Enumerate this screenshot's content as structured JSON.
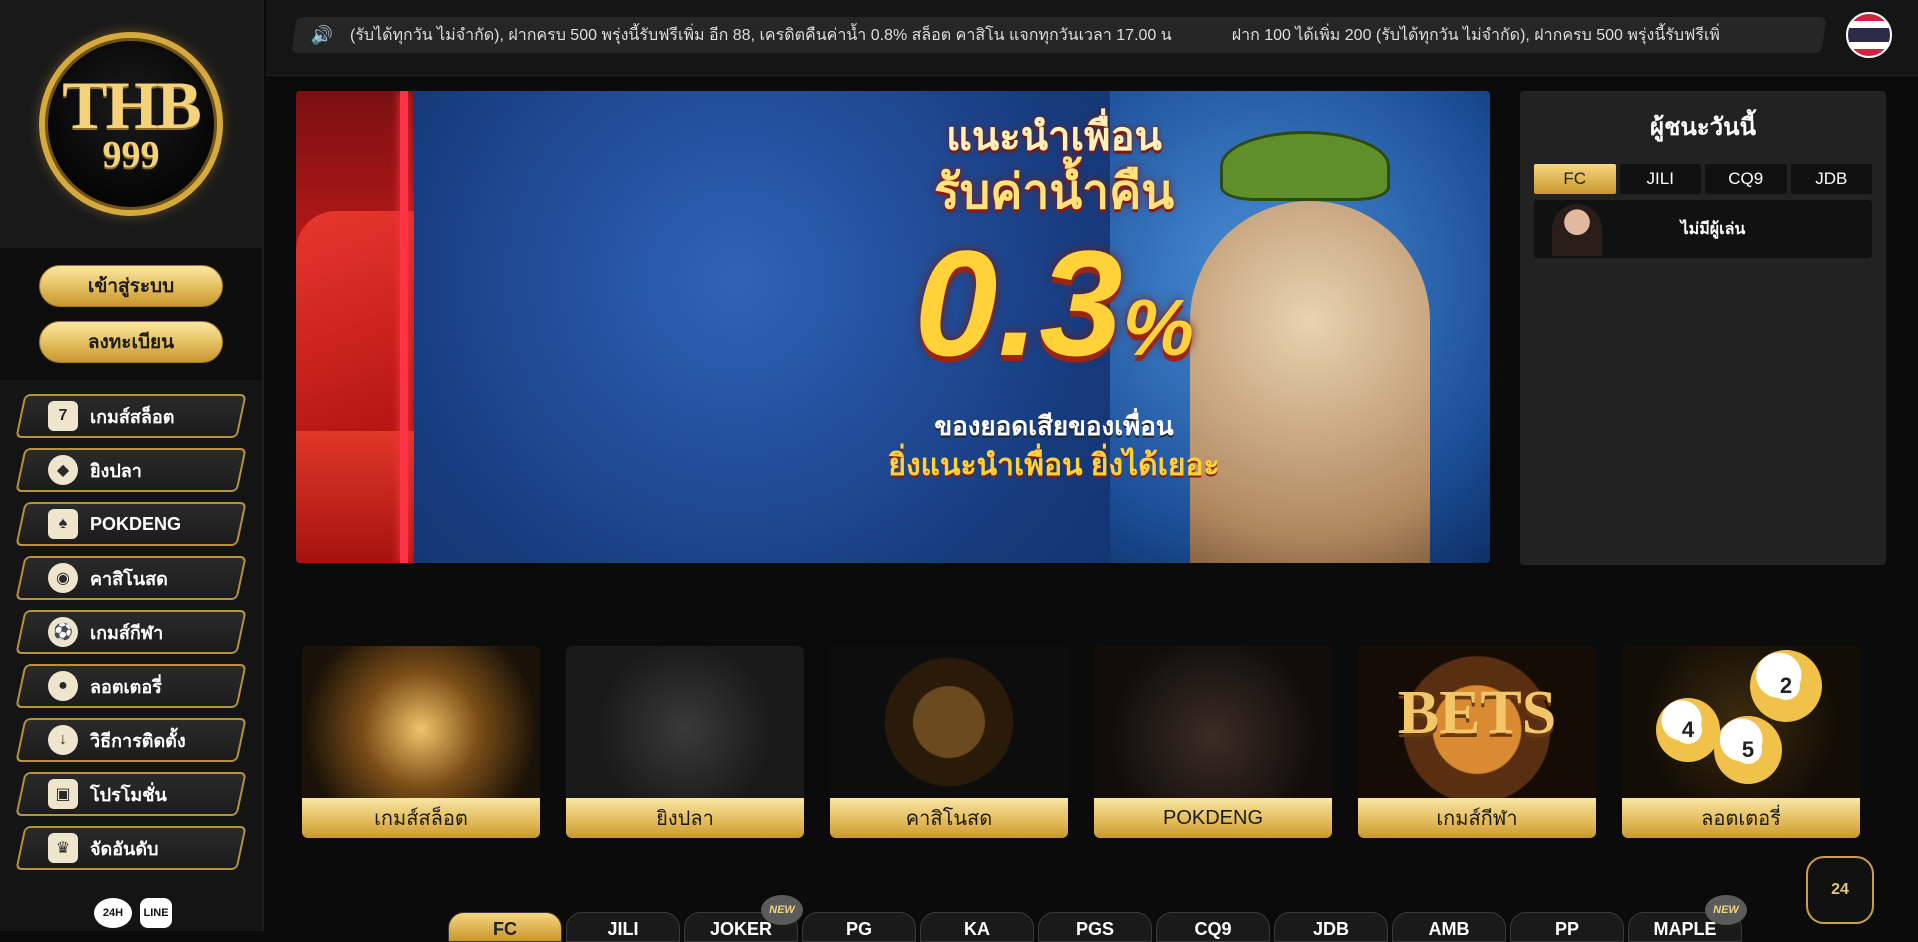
{
  "brand": {
    "logo_top": "THB",
    "logo_bottom": "999"
  },
  "auth": {
    "login": "เข้าสู่ระบบ",
    "register": "ลงทะเบียน"
  },
  "menu": [
    {
      "label": "เกมส์สล็อต",
      "icon": "slot-icon"
    },
    {
      "label": "ยิงปลา",
      "icon": "fish-icon"
    },
    {
      "label": "POKDENG",
      "icon": "cards-icon"
    },
    {
      "label": "คาสิโนสด",
      "icon": "casino-chip-icon"
    },
    {
      "label": "เกมส์กีฬา",
      "icon": "soccer-ball-icon"
    },
    {
      "label": "ลอตเตอรี่",
      "icon": "lottery-ball-icon"
    },
    {
      "label": "วิธีการติดตั้ง",
      "icon": "download-icon"
    },
    {
      "label": "โปรโมชั่น",
      "icon": "gift-icon"
    },
    {
      "label": "จัดอันดับ",
      "icon": "trophy-icon"
    }
  ],
  "bottom_icons": {
    "support24": "24H",
    "line": "LINE"
  },
  "marquee": {
    "part1": "(รับได้ทุกวัน ไม่จำกัด), ฝากครบ 500 พรุ่งนี้รับฟรีเพิ่ม อีก 88, เครดิตคืนค่าน้ำ 0.8% สล็อต คาสิโน แจกทุกวันเวลา 17.00 น",
    "part2": "ฝาก 100 ได้เพิ่ม 200 (รับได้ทุกวัน ไม่จำกัด), ฝากครบ 500 พรุ่งนี้รับฟรีเพิ่"
  },
  "banner": {
    "line1": "แนะนำเพื่อน",
    "line2": "รับค่าน้ำคืน",
    "big": "0.3",
    "pct": "%",
    "line3": "ของยอดเสียของเพื่อน",
    "line4": "ยิ่งแนะนำเพื่อน ยิ่งได้เยอะ"
  },
  "winners": {
    "title": "ผู้ชนะวันนี้",
    "tabs": [
      "FC",
      "JILI",
      "CQ9",
      "JDB"
    ],
    "active_tab": "FC",
    "empty_text": "ไม่มีผู้เล่น"
  },
  "categories": [
    {
      "label": "เกมส์สล็อต"
    },
    {
      "label": "ยิงปลา"
    },
    {
      "label": "คาสิโนสด"
    },
    {
      "label": "POKDENG"
    },
    {
      "label": "เกมส์กีฬา",
      "art_text": "BETS"
    },
    {
      "label": "ลอตเตอรี่",
      "balls": [
        "4",
        "2",
        "5"
      ]
    }
  ],
  "providers": {
    "tabs": [
      "FC",
      "JILI",
      "JOKER",
      "PG",
      "KA",
      "PGS",
      "CQ9",
      "JDB",
      "AMB",
      "PP",
      "MAPLE"
    ],
    "new_badge": "NEW"
  },
  "support": {
    "label": "24"
  },
  "colors": {
    "gold": "#d6a93e",
    "gold_light": "#f8e6a4",
    "bg": "#0b0b0b",
    "panel": "#222222"
  }
}
